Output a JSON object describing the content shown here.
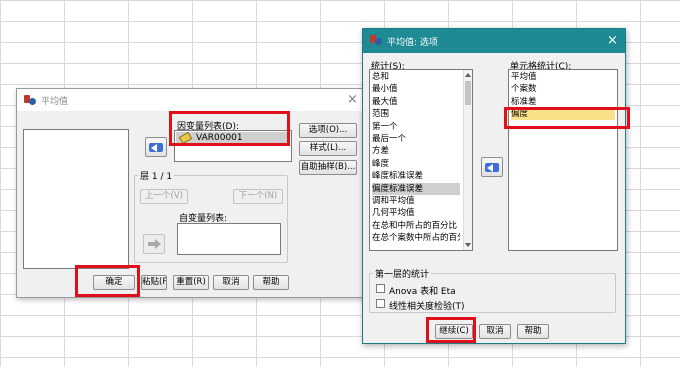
{
  "means_dialog": {
    "title": "平均值",
    "dependent_list_label": "因变量列表(D):",
    "dependent_item": "VAR00001",
    "layer_label": "层 1 / 1",
    "prev_button": "上一个(V)",
    "next_button": "下一个(N)",
    "independent_list_label": "自变量列表:",
    "buttons": {
      "options": "选项(O)...",
      "style": "样式(L)...",
      "bootstrap": "自助抽样(B)...",
      "ok": "确定",
      "paste": "粘贴(P)",
      "reset": "重置(R)",
      "cancel": "取消",
      "help": "帮助"
    }
  },
  "options_dialog": {
    "title": "平均值: 选项",
    "statistics_label": "统计(S):",
    "statistics": [
      "总和",
      "最小值",
      "最大值",
      "范围",
      "第一个",
      "最后一个",
      "方差",
      "峰度",
      "峰度标准误差",
      "偏度标准误差",
      "调和平均值",
      "几何平均值",
      "在总和中所占的百分比",
      "在总个案数中所占的百分比"
    ],
    "statistics_selected_index": 9,
    "cell_statistics_label": "单元格统计(C):",
    "cell_statistics": [
      "平均值",
      "个案数",
      "标准差",
      "偏度"
    ],
    "cell_statistics_highlight_index": 3,
    "first_layer_label": "第一层的统计",
    "anova_label": "Anova 表和 Eta",
    "linearity_label": "线性相关度检验(T)",
    "buttons": {
      "continue": "继续(C)",
      "cancel": "取消",
      "help": "帮助"
    }
  },
  "colors": {
    "highlight_red": "#e0101a",
    "title_teal": "#1e8a94",
    "cell_highlight": "#fbe08a"
  }
}
